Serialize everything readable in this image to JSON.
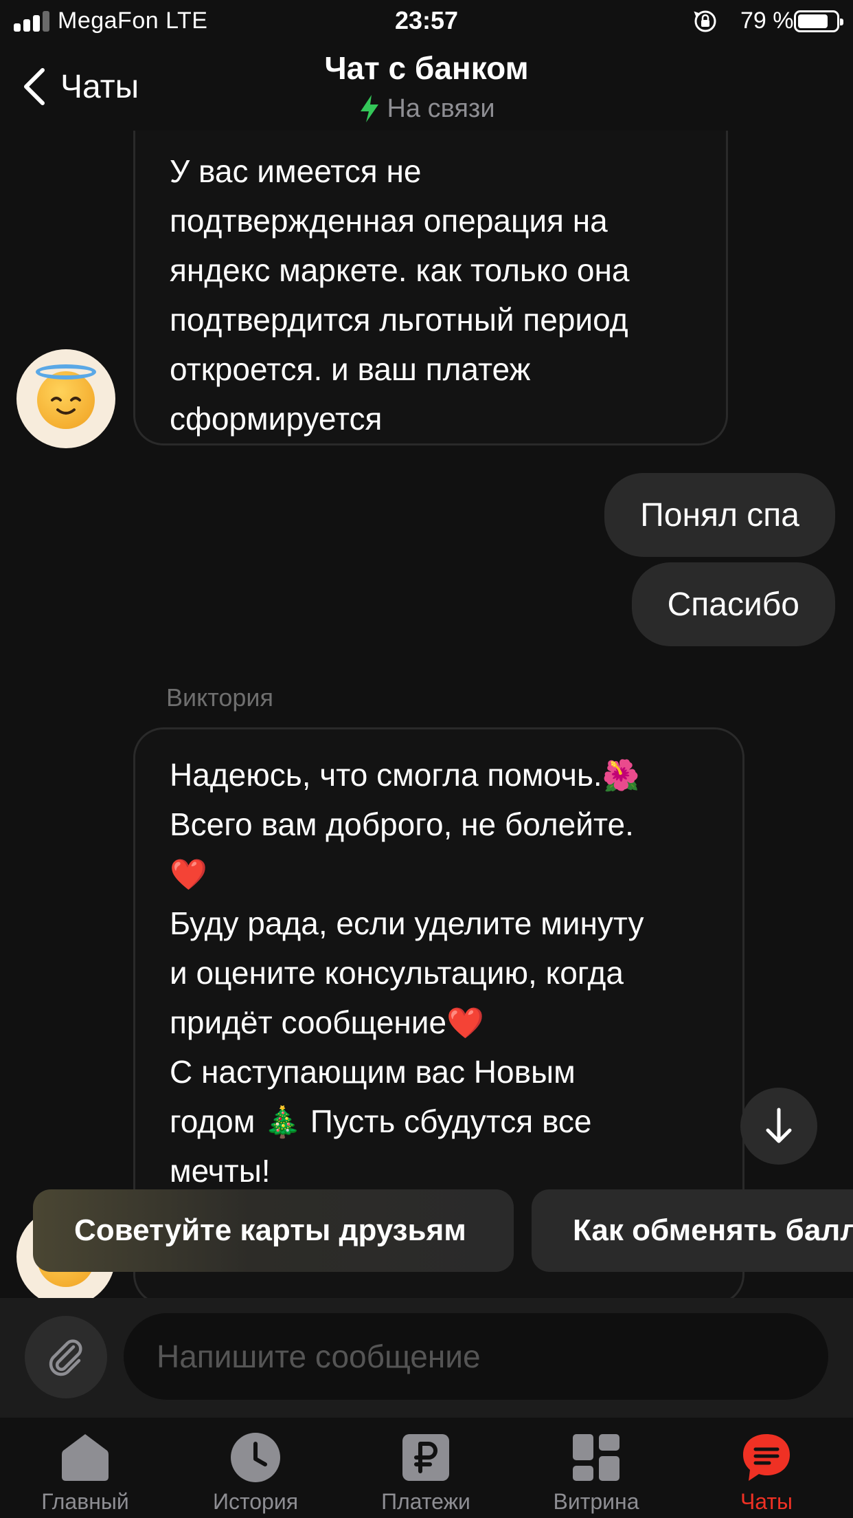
{
  "status_bar": {
    "carrier": "MegaFon  LTE",
    "time": "23:57",
    "battery_percent": "79 %",
    "battery_level": 0.79
  },
  "header": {
    "back_label": "Чаты",
    "title": "Чат с банком",
    "status": "На связи"
  },
  "messages": [
    {
      "direction": "incoming",
      "text": "У вас имеется не\nподтвержденная операция на\nяндекс маркете. как только она\nподтвердится льготный период\nоткроется. и ваш платеж\nсформируется"
    },
    {
      "direction": "outgoing",
      "text": "Понял спа"
    },
    {
      "direction": "outgoing",
      "text": "Спасибо"
    },
    {
      "direction": "incoming",
      "sender": "Виктория",
      "lines": [
        "Надеюсь, что смогла помочь.",
        "Всего вам доброго, не болейте.",
        "Буду рада, если уделите минуту",
        "и оцените консультацию, когда",
        "придёт сообщение",
        "С наступающим вас Новым",
        "годом ",
        "Пусть сбудутся все",
        "мечты!"
      ],
      "emojis": [
        "🌺",
        "❤️",
        "❤️",
        "🎄"
      ]
    }
  ],
  "suggestions": [
    "Советуйте карты друзьям",
    "Как обменять балл"
  ],
  "composer": {
    "placeholder": "Напишите сообщение"
  },
  "tabs": [
    {
      "label": "Главный",
      "icon": "home-icon"
    },
    {
      "label": "История",
      "icon": "clock-icon"
    },
    {
      "label": "Платежи",
      "icon": "ruble-icon"
    },
    {
      "label": "Витрина",
      "icon": "grid-icon"
    },
    {
      "label": "Чаты",
      "icon": "chat-icon",
      "active": true
    }
  ],
  "colors": {
    "accent": "#ef3124",
    "online": "#34c759",
    "background": "#111111"
  }
}
